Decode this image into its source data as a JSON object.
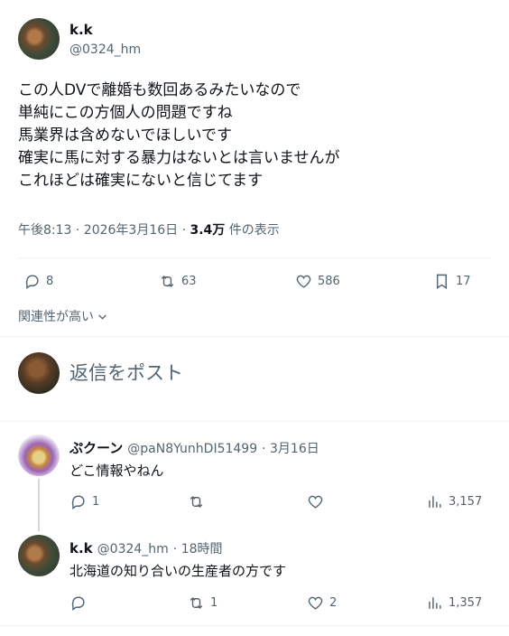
{
  "tweet": {
    "name": "k.k",
    "handle": "@0324_hm",
    "lines": [
      "この人DVで離婚も数回あるみたいなので",
      "単純にこの方個人の問題ですね",
      "馬業界は含めないでほしいです",
      "確実に馬に対する暴力はないとは言いませんが",
      "これほどは確実にないと信じてます"
    ],
    "timestamp": "午後8:13 · 2026年3月16日 · ",
    "views_count": "3.4万",
    "views_label": " 件の表示",
    "stats": {
      "replies": "8",
      "retweets": "63",
      "likes": "586",
      "bookmarks": "17"
    }
  },
  "sort_label": "関連性が高い",
  "compose": {
    "placeholder": "返信をポスト"
  },
  "replies": [
    {
      "name": "ぷクーン",
      "handle": "@paN8YunhDI51499",
      "time": "· 3月16日",
      "text": "どこ情報やねん",
      "stats": {
        "replies": "1",
        "retweets": "",
        "likes": "",
        "views": "3,157"
      }
    },
    {
      "name": "k.k",
      "handle": "@0324_hm",
      "time": "· 18時間",
      "text": "北海道の知り合いの生産者の方です",
      "stats": {
        "replies": "",
        "retweets": "1",
        "likes": "2",
        "views": "1,357"
      }
    }
  ]
}
